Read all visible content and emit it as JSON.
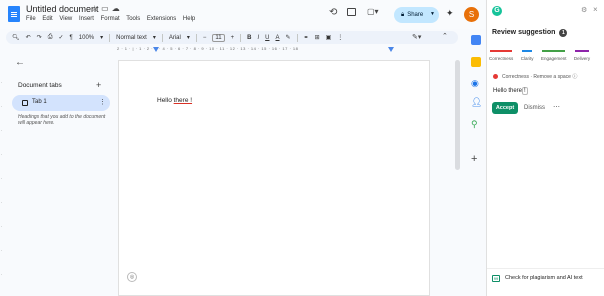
{
  "document": {
    "title": "Untitled document",
    "menu": [
      "File",
      "Edit",
      "View",
      "Insert",
      "Format",
      "Tools",
      "Extensions",
      "Help"
    ],
    "share_label": "Share",
    "avatar_initial": "S"
  },
  "toolbar": {
    "zoom": "100%",
    "style": "Normal text",
    "font": "Arial",
    "font_size": "11"
  },
  "ruler_text": "2 · 1 · | · 1 · 2 · 3 · 4 · 5 · 6 · 7 · 8 · 9 · 10 · 11 · 12 · 13 · 14 · 15 · 16 · 17 · 18",
  "sidebar": {
    "heading": "Document tabs",
    "tabs": [
      {
        "label": "Tab 1"
      }
    ],
    "hint": "Headings that you add to the document will appear here."
  },
  "page": {
    "text_before": "Hello ",
    "text_error": "there !"
  },
  "grammarly": {
    "heading": "Review suggestion",
    "count": "1",
    "tabs": [
      "Correctness",
      "Clarity",
      "Engagement",
      "Delivery"
    ],
    "card_category": "Correctness",
    "card_action": "Remove a space",
    "suggestion_before": "Hello there",
    "suggestion_mark": "!",
    "accept_label": "Accept",
    "dismiss_label": "Dismiss",
    "footer": "Check for plagiarism and AI text"
  },
  "colors": {
    "accent": "#0e8f67",
    "share_bg": "#c2e7ff",
    "error": "#d93025"
  }
}
